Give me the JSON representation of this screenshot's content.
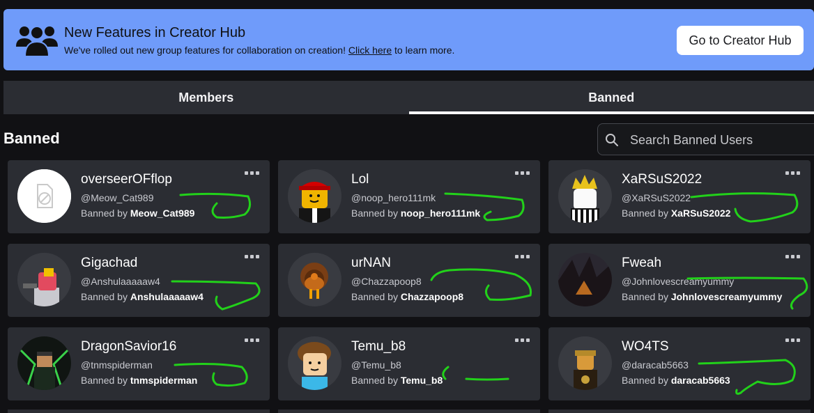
{
  "banner": {
    "icon": "group-icon",
    "title": "New Features in Creator Hub",
    "desc_prefix": "We've rolled out new group features for collaboration on creation!",
    "link": "Click here",
    "desc_suffix": "to learn more.",
    "button": "Go to Creator Hub"
  },
  "tabs": [
    {
      "label": "Members",
      "active": false
    },
    {
      "label": "Banned",
      "active": true
    }
  ],
  "section_title": "Banned",
  "search": {
    "placeholder": "Search Banned Users",
    "icon": "search-icon"
  },
  "banned_by_prefix": "Banned by",
  "users": [
    {
      "name": "overseerOFflop",
      "handle": "@Meow_Cat989",
      "banned_by": "Meow_Cat989",
      "avatar": "placeholder-avatar"
    },
    {
      "name": "Lol",
      "handle": "@noop_hero111mk",
      "banned_by": "noop_hero111mk",
      "avatar": "red-cap-avatar"
    },
    {
      "name": "XaRSuS2022",
      "handle": "@XaRSuS2022",
      "banned_by": "XaRSuS2022",
      "avatar": "crowned-avatar"
    },
    {
      "name": "Gigachad",
      "handle": "@Anshulaaaaaw4",
      "banned_by": "Anshulaaaaaw4",
      "avatar": "pink-hair-avatar"
    },
    {
      "name": "urNAN",
      "handle": "@Chazzapoop8",
      "banned_by": "Chazzapoop8",
      "avatar": "turkey-avatar"
    },
    {
      "name": "Fweah",
      "handle": "@Johnlovescreamyummy",
      "banned_by": "Johnlovescreamyummy",
      "avatar": "dark-hair-avatar"
    },
    {
      "name": "DragonSavior16",
      "handle": "@tnmspiderman",
      "banned_by": "tnmspiderman",
      "avatar": "dragon-avatar"
    },
    {
      "name": "Temu_b8",
      "handle": "@Temu_b8",
      "banned_by": "Temu_b8",
      "avatar": "bacon-hair-avatar"
    },
    {
      "name": "WO4TS",
      "handle": "@daracab5663",
      "banned_by": "daracab5663",
      "avatar": "pirate-avatar"
    }
  ],
  "colors": {
    "banner_bg": "#6f9bfa",
    "card_bg": "#2b2d33",
    "page_bg": "#111114",
    "annotation_green": "#22d11a"
  }
}
